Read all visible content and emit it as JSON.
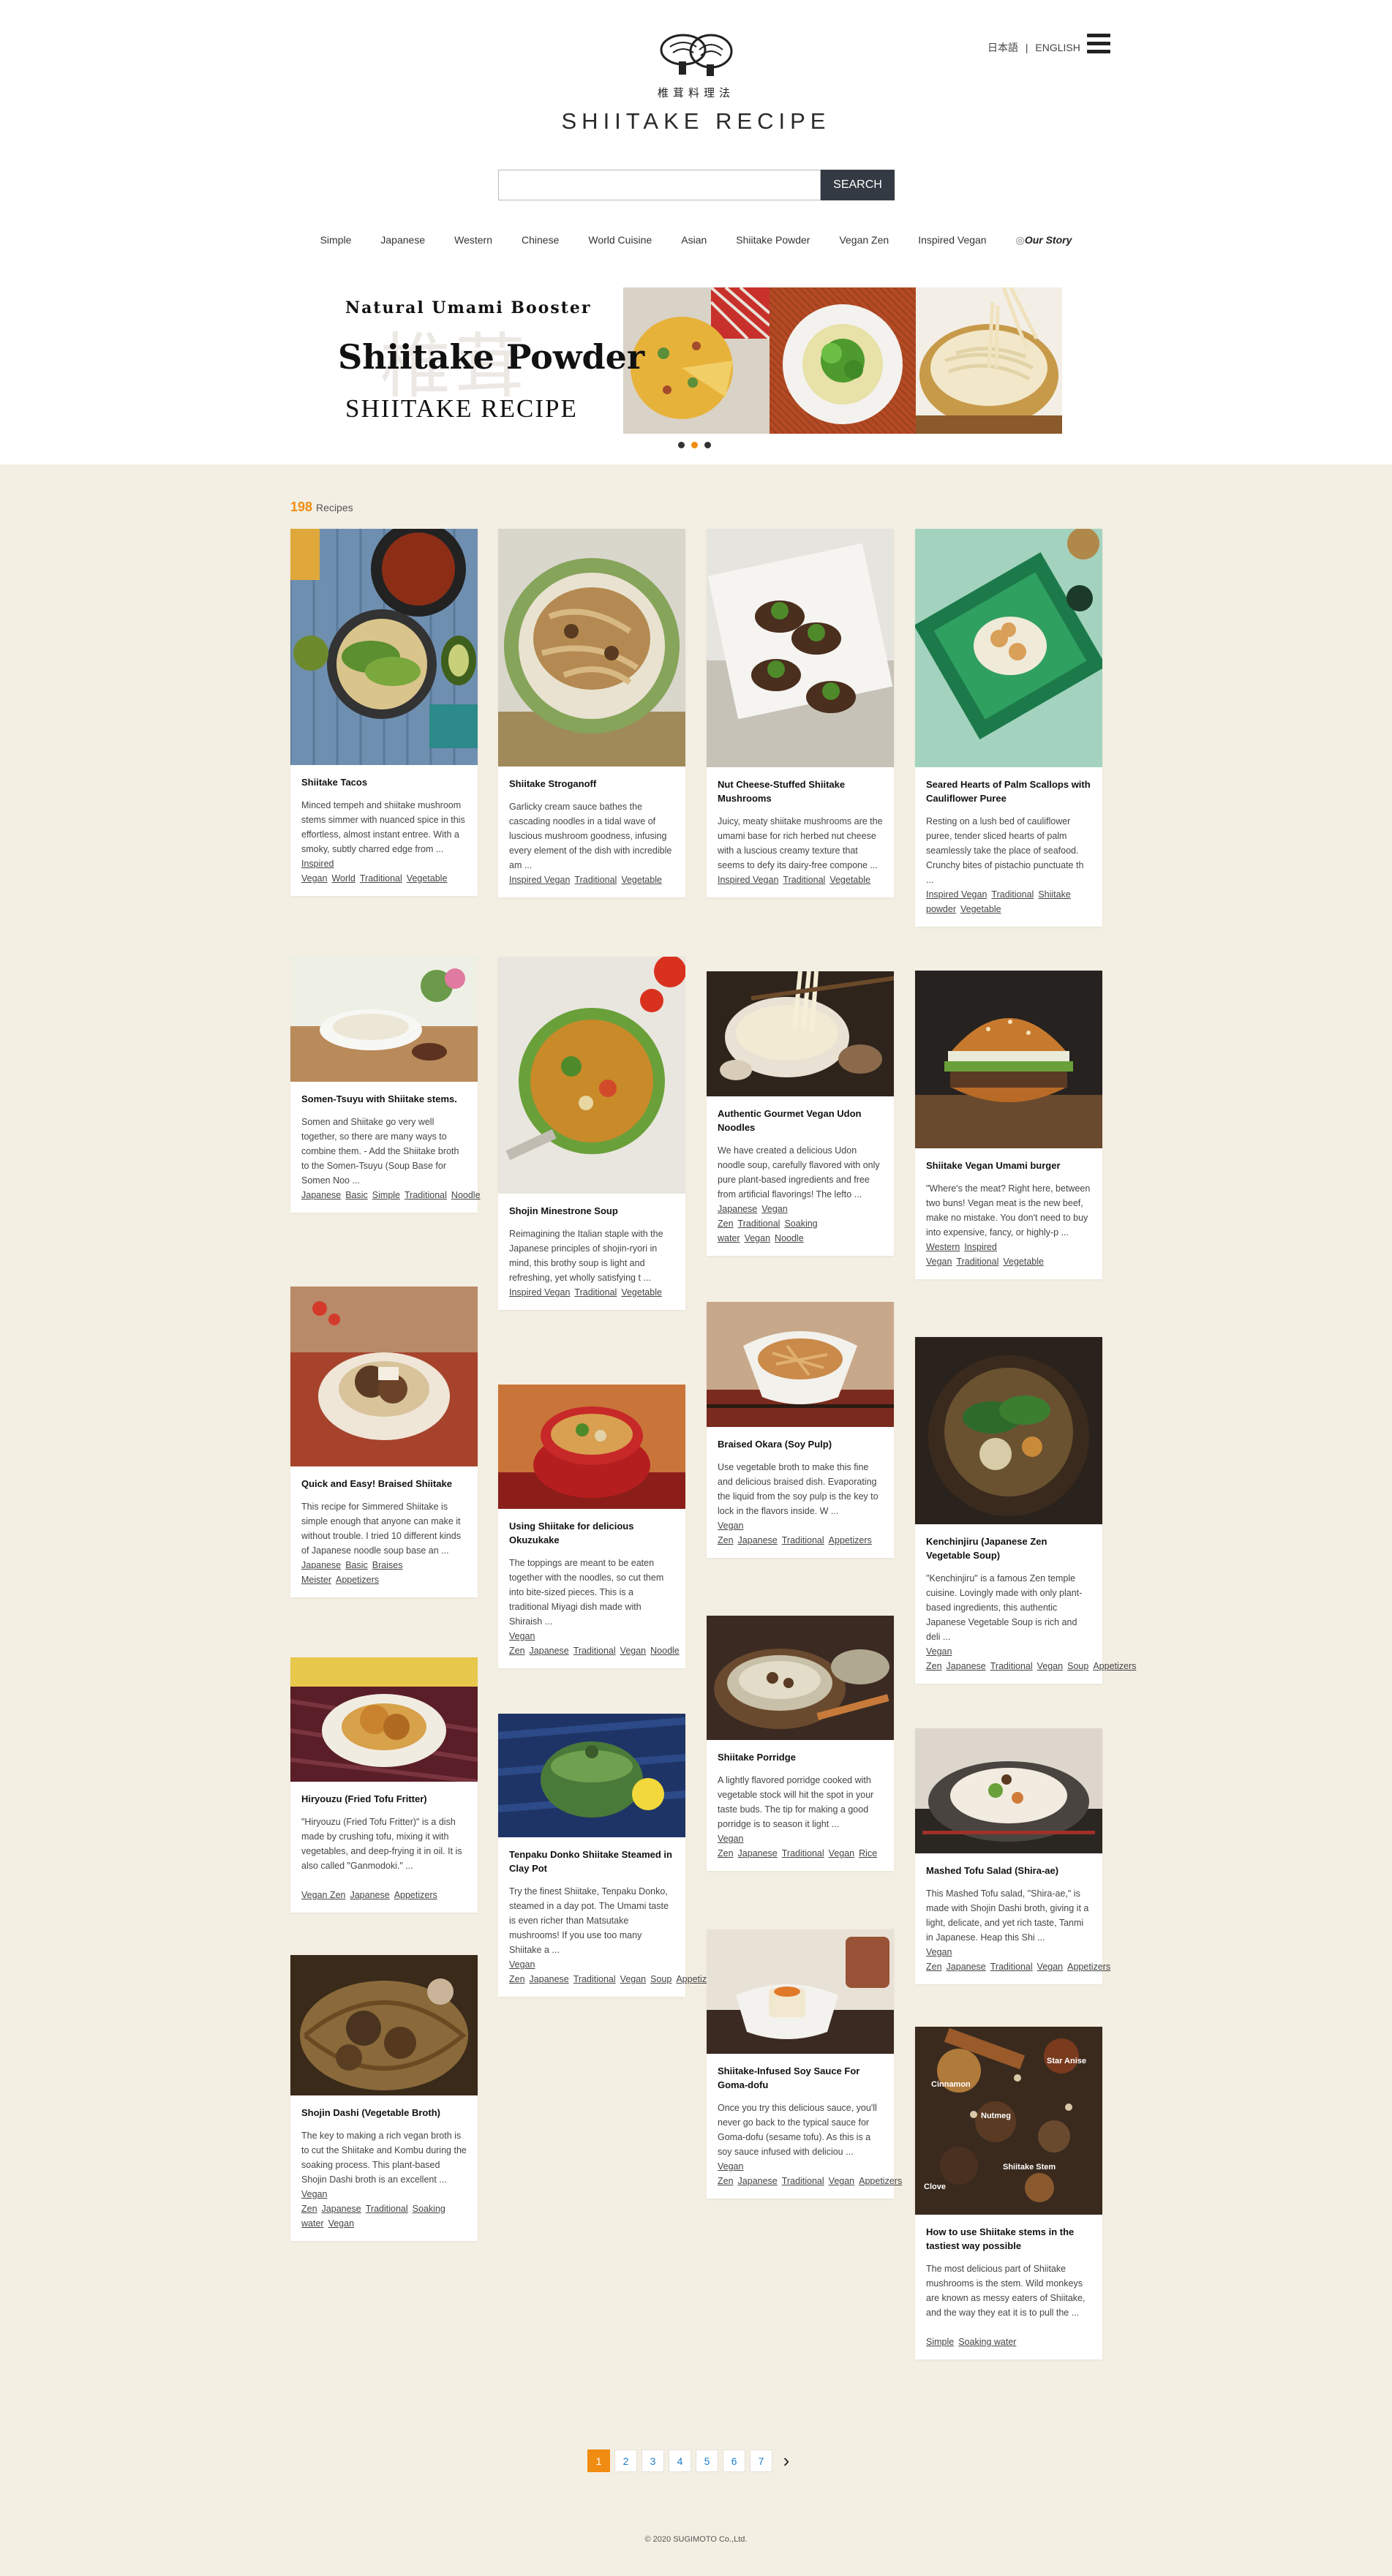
{
  "header": {
    "logo_sub": "椎茸料理法",
    "logo_title": "SHIITAKE RECIPE",
    "lang_ja": "日本語",
    "lang_sep": "|",
    "lang_en": "ENGLISH",
    "search_placeholder": "",
    "search_button": "SEARCH"
  },
  "nav": [
    "Simple",
    "Japanese",
    "Western",
    "Chinese",
    "World Cuisine",
    "Asian",
    "Shiitake Powder",
    "Vegan Zen",
    "Inspired Vegan",
    "Our Story"
  ],
  "banner": {
    "subtitle": "Natural Umami Booster",
    "title": "Shiitake Powder",
    "brand": "SHIITAKE RECIPE",
    "kanji": "椎茸",
    "slides": 3,
    "active_slide": 2
  },
  "count": {
    "number": "198",
    "label": "Recipes"
  },
  "colors": {
    "accent": "#f08c12",
    "background": "#f4efe3",
    "search_button": "#333a43",
    "link": "#1e7bc8"
  },
  "recipes": [
    {
      "title": "Shiitake Tacos",
      "desc": "Minced tempeh and shiitake mushroom stems simmer with nuanced spice in this effortless, almost instant entree. With a smoky, subtly charred edge from ...",
      "tags": [
        "Inspired Vegan",
        "World",
        "Traditional",
        "Vegetable"
      ]
    },
    {
      "title": "Somen-Tsuyu with Shiitake stems.",
      "desc": "Somen and Shiitake go very well together, so there are many ways to combine them. - Add the Shiitake broth to the Somen-Tsuyu (Soup Base for Somen Noo ...",
      "tags": [
        "Japanese",
        "Basic",
        "Simple",
        "Traditional",
        "Noodle"
      ]
    },
    {
      "title": "Quick and Easy! Braised Shiitake",
      "desc": "This recipe for Simmered Shiitake is simple enough that anyone can make it without trouble. I tried 10 different kinds of Japanese noodle soup base an ...",
      "tags": [
        "Japanese",
        "Basic",
        "Braises Meister",
        "Appetizers"
      ]
    },
    {
      "title": "Hiryouzu (Fried Tofu Fritter)",
      "desc": "\"Hiryouzu (Fried Tofu Fritter)\" is a dish made by crushing tofu, mixing it with vegetables, and deep-frying it in oil. It is also called \"Ganmodoki.\" ...",
      "tags": [
        "Vegan Zen",
        "Japanese",
        "Appetizers"
      ]
    },
    {
      "title": "Shojin Dashi (Vegetable Broth)",
      "desc": "The key to making a rich vegan broth is to cut the Shiitake and Kombu during the soaking process. This plant-based Shojin Dashi broth is an excellent ...",
      "tags": [
        "Vegan Zen",
        "Japanese",
        "Traditional",
        "Soaking water",
        "Vegan"
      ]
    },
    {
      "title": "Shiitake Stroganoff",
      "desc": "Garlicky cream sauce bathes the cascading noodles in a tidal wave of luscious mushroom goodness, infusing every element of the dish with incredible am ...",
      "tags": [
        "Inspired Vegan",
        "Traditional",
        "Vegetable"
      ]
    },
    {
      "title": "Shojin Minestrone Soup",
      "desc": "Reimagining the Italian staple with the Japanese principles of shojin-ryori in mind, this brothy soup is light and refreshing, yet wholly satisfying t ...",
      "tags": [
        "Inspired Vegan",
        "Traditional",
        "Vegetable"
      ]
    },
    {
      "title": "Using Shiitake for delicious Okuzukake",
      "desc": "The toppings are meant to be eaten together with the noodles, so cut them into bite-sized pieces. This is a traditional Miyagi dish made with Shiraish ...",
      "tags": [
        "Vegan Zen",
        "Japanese",
        "Traditional",
        "Vegan",
        "Noodle"
      ]
    },
    {
      "title": "Tenpaku Donko Shiitake Steamed in Clay Pot",
      "desc": "Try the finest Shiitake, Tenpaku Donko, steamed in a day pot. The Umami taste is even richer than Matsutake mushrooms! If you use too many Shiitake a ...",
      "tags": [
        "Vegan Zen",
        "Japanese",
        "Traditional",
        "Vegan",
        "Soup",
        "Appetizers"
      ]
    },
    {
      "title": "Nut Cheese-Stuffed Shiitake Mushrooms",
      "desc": "Juicy, meaty shiitake mushrooms are the umami base for rich herbed nut cheese with a luscious creamy texture that seems to defy its dairy-free compone ...",
      "tags": [
        "Inspired Vegan",
        "Traditional",
        "Vegetable"
      ]
    },
    {
      "title": "Authentic Gourmet Vegan Udon Noodles",
      "desc": "We have created a delicious Udon noodle soup, carefully flavored with only pure plant-based ingredients and free from artificial flavorings! The lefto ...",
      "tags": [
        "Japanese",
        "Vegan Zen",
        "Traditional",
        "Soaking water",
        "Vegan",
        "Noodle"
      ]
    },
    {
      "title": "Braised Okara (Soy Pulp)",
      "desc": "Use vegetable broth to make this fine and delicious braised dish. Evaporating the liquid from the soy pulp is the key to lock in the flavors inside. W ...",
      "tags": [
        "Vegan Zen",
        "Japanese",
        "Traditional",
        "Appetizers"
      ]
    },
    {
      "title": "Shiitake Porridge",
      "desc": "A lightly flavored porridge cooked with vegetable stock will hit the spot in your taste buds. The tip for making a good porridge is to season it light ...",
      "tags": [
        "Vegan Zen",
        "Japanese",
        "Traditional",
        "Vegan",
        "Rice"
      ]
    },
    {
      "title": "Shiitake-Infused Soy Sauce For Goma-dofu",
      "desc": "Once you try this delicious sauce, you'll never go back to the typical sauce for Goma-dofu (sesame tofu). As this is a soy sauce infused with deliciou ...",
      "tags": [
        "Vegan Zen",
        "Japanese",
        "Traditional",
        "Vegan",
        "Appetizers"
      ]
    },
    {
      "title": "Seared Hearts of Palm Scallops with Cauliflower Puree",
      "desc": "Resting on a lush bed of cauliflower puree, tender sliced hearts of palm seamlessly take the place of seafood. Crunchy bites of pistachio punctuate th ...",
      "tags": [
        "Inspired Vegan",
        "Traditional",
        "Shiitake powder",
        "Vegetable"
      ]
    },
    {
      "title": "Shiitake Vegan Umami burger",
      "desc": "\"Where's the meat? Right here, between two buns! Vegan meat is the new beef, make no mistake. You don't need to buy into expensive, fancy, or highly-p ...",
      "tags": [
        "Western",
        "Inspired Vegan",
        "Traditional",
        "Vegetable"
      ]
    },
    {
      "title": "Kenchinjiru (Japanese Zen Vegetable Soup)",
      "desc": "\"Kenchinjiru\" is a famous Zen temple cuisine. Lovingly made with only plant-based ingredients, this authentic Japanese Vegetable Soup is rich and deli ...",
      "tags": [
        "Vegan Zen",
        "Japanese",
        "Traditional",
        "Vegan",
        "Soup",
        "Appetizers"
      ]
    },
    {
      "title": "Mashed Tofu Salad (Shira-ae)",
      "desc": "This Mashed Tofu salad, \"Shira-ae,\" is made with Shojin Dashi broth, giving it a light, delicate, and yet rich taste, Tanmi in Japanese. Heap this Shi ...",
      "tags": [
        "Vegan Zen",
        "Japanese",
        "Traditional",
        "Vegan",
        "Appetizers"
      ]
    },
    {
      "title": "How to use Shiitake stems in the tastiest way possible",
      "desc": "The most delicious part of Shiitake mushrooms is the stem. Wild monkeys are known as messy eaters of Shiitake, and the way they eat it is to pull the ...",
      "tags": [
        "Simple",
        "Soaking water"
      ]
    }
  ],
  "spice_labels": [
    "Star Anise",
    "Cinnamon",
    "Nutmeg",
    "Shiitake Stem",
    "Clove"
  ],
  "pagination": {
    "pages": [
      "1",
      "2",
      "3",
      "4",
      "5",
      "6",
      "7"
    ],
    "current": "1",
    "next": "›"
  },
  "footer": "© 2020 SUGIMOTO Co.,Ltd."
}
